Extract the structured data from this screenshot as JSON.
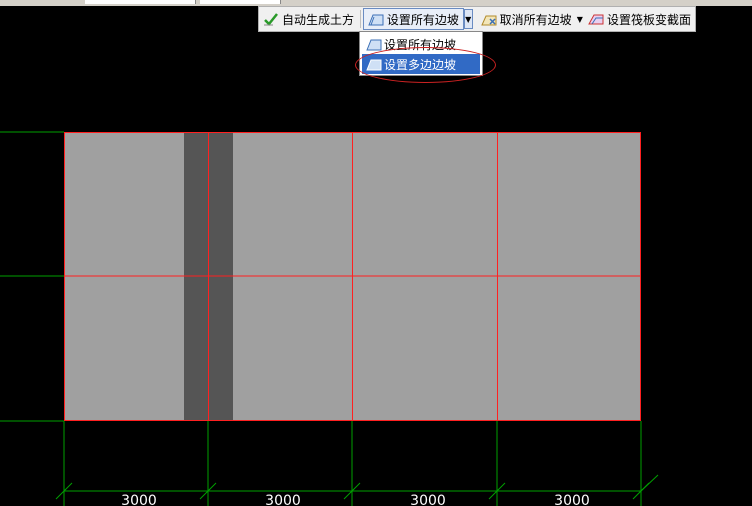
{
  "toolbar": {
    "auto_earthwork_label": "自动生成土方",
    "set_all_slopes_label": "设置所有边坡",
    "cancel_all_slopes_label": "取消所有边坡",
    "set_raft_section_label": "设置筏板变截面"
  },
  "dropdown": {
    "items": [
      {
        "label": "设置所有边坡",
        "selected": false
      },
      {
        "label": "设置多边边坡",
        "selected": true
      }
    ]
  },
  "drawing": {
    "dimensions": [
      "3000",
      "3000",
      "3000",
      "3000"
    ],
    "colors": {
      "background": "#000000",
      "slab_fill": "#a0a0a0",
      "strip_fill": "#555555",
      "slab_edge": "#ff0000",
      "axis_lines": "#00a000",
      "dimension_text": "#ffffff"
    }
  }
}
